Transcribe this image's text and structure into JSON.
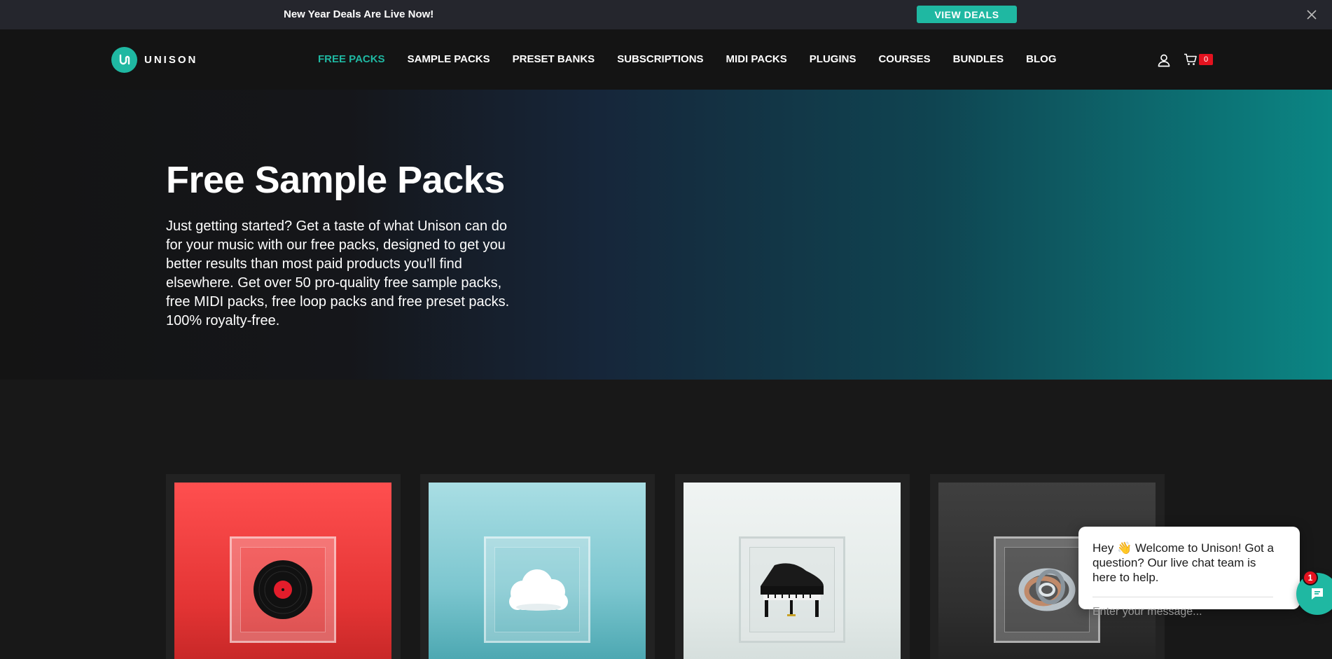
{
  "announcement": {
    "text": "New Year Deals Are Live Now!",
    "button_label": "VIEW DEALS",
    "close_icon": "close-icon"
  },
  "header": {
    "logo_text": "UNISON",
    "nav": [
      {
        "label": "FREE PACKS",
        "active": true
      },
      {
        "label": "SAMPLE PACKS",
        "active": false
      },
      {
        "label": "PRESET BANKS",
        "active": false
      },
      {
        "label": "SUBSCRIPTIONS",
        "active": false
      },
      {
        "label": "MIDI PACKS",
        "active": false
      },
      {
        "label": "PLUGINS",
        "active": false
      },
      {
        "label": "COURSES",
        "active": false
      },
      {
        "label": "BUNDLES",
        "active": false
      },
      {
        "label": "BLOG",
        "active": false
      }
    ],
    "account_icon": "user-icon",
    "cart_icon": "cart-icon",
    "cart_count": "0"
  },
  "hero": {
    "title": "Free Sample Packs",
    "description": "Just getting started? Get a taste of what Unison can do for your music with our free packs, designed to get you better results than most paid products you'll find elsewhere. Get over 50 pro-quality free sample packs, free MIDI packs, free loop packs and free preset packs. 100% royalty-free."
  },
  "products": [
    {
      "image": "vinyl-record",
      "bg_top": "#ff4e4e",
      "bg_bottom": "#d62c2c"
    },
    {
      "image": "cloud",
      "bg_top": "#a8dde3",
      "bg_bottom": "#4eacb5"
    },
    {
      "image": "grand-piano",
      "bg_top": "#eef3f2",
      "bg_bottom": "#d8e1df"
    },
    {
      "image": "metal-knot",
      "bg_top": "#3e3e3e",
      "bg_bottom": "#262626"
    }
  ],
  "chat": {
    "welcome": "Hey 👋 Welcome to Unison! Got a question? Our live chat team is here to help.",
    "input_placeholder": "Enter your message...",
    "badge_count": "1"
  },
  "colors": {
    "accent": "#1fb8a2",
    "badge": "#e4121f",
    "page_bg": "#181818"
  }
}
